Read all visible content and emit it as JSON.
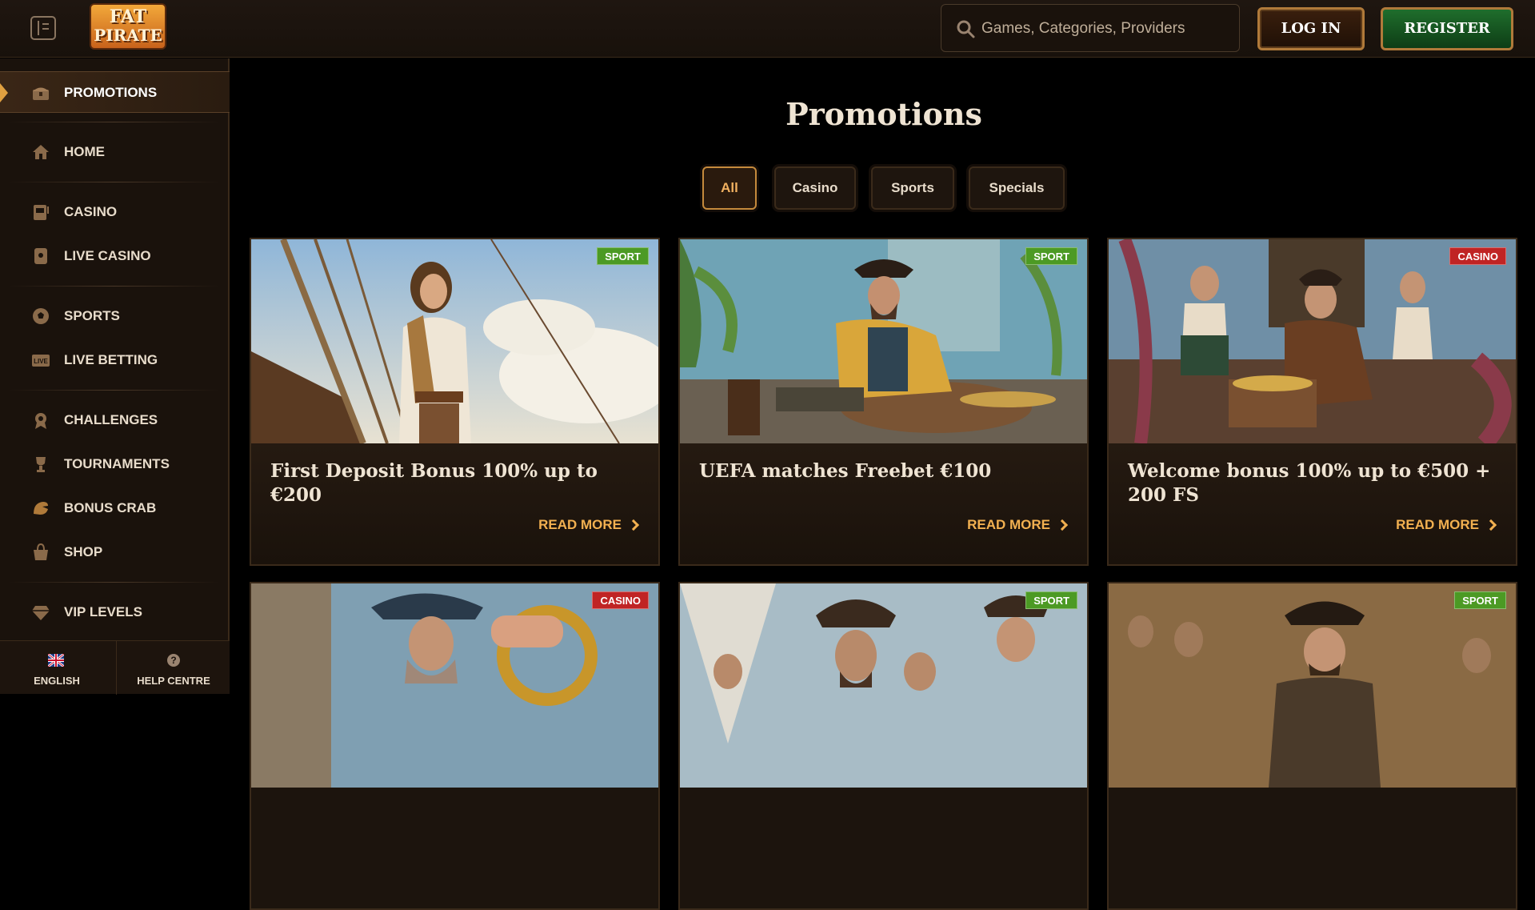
{
  "header": {
    "logo_line1": "FAT",
    "logo_line2": "PIRATE",
    "search_placeholder": "Games, Categories, Providers",
    "login_label": "LOG IN",
    "register_label": "REGISTER"
  },
  "sidebar": {
    "items": [
      {
        "label": "PROMOTIONS",
        "icon": "treasure-chest-icon"
      },
      {
        "label": "HOME",
        "icon": "house-icon"
      },
      {
        "label": "CASINO",
        "icon": "slot-machine-icon"
      },
      {
        "label": "LIVE CASINO",
        "icon": "live-card-icon"
      },
      {
        "label": "SPORTS",
        "icon": "football-icon"
      },
      {
        "label": "LIVE BETTING",
        "icon": "live-tv-icon"
      },
      {
        "label": "CHALLENGES",
        "icon": "medal-icon"
      },
      {
        "label": "TOURNAMENTS",
        "icon": "trophy-icon"
      },
      {
        "label": "BONUS CRAB",
        "icon": "crab-claw-icon"
      },
      {
        "label": "SHOP",
        "icon": "shopping-bag-icon"
      },
      {
        "label": "VIP LEVELS",
        "icon": "diamond-icon"
      }
    ],
    "footer": {
      "language_label": "ENGLISH",
      "help_label": "HELP CENTRE",
      "help_icon_glyph": "?"
    }
  },
  "main": {
    "title": "Promotions",
    "filters": [
      "All",
      "Casino",
      "Sports",
      "Specials"
    ],
    "active_filter": "All",
    "read_more_label": "READ MORE",
    "cards": [
      {
        "title": "First Deposit Bonus 100% up to €200",
        "badge": "SPORT"
      },
      {
        "title": "UEFA matches Freebet €100",
        "badge": "SPORT"
      },
      {
        "title": "Welcome bonus 100% up to €500 + 200 FS",
        "badge": "CASINO"
      },
      {
        "title": "",
        "badge": "CASINO"
      },
      {
        "title": "",
        "badge": "SPORT"
      },
      {
        "title": "",
        "badge": "SPORT"
      }
    ]
  },
  "colors": {
    "accent": "#f2b050",
    "sport_badge": "#4c9a24",
    "casino_badge": "#c02424",
    "register_green": "#1f6e2c"
  }
}
